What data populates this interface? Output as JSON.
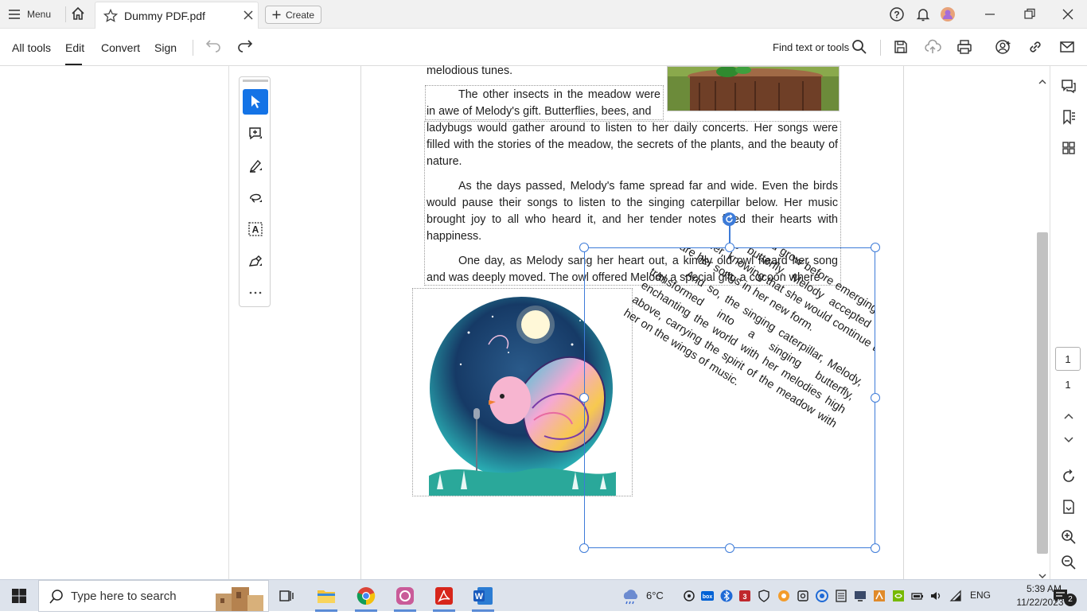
{
  "titlebar": {
    "menu_label": "Menu",
    "tab_title": "Dummy PDF.pdf",
    "create_label": "Create"
  },
  "toolbar": {
    "all_tools": "All tools",
    "edit": "Edit",
    "convert": "Convert",
    "sign": "Sign",
    "find_label": "Find text or tools"
  },
  "document": {
    "line0": "melodious tunes.",
    "para1_col": "The other insects in the meadow were in awe of Melody's gift. Butterflies, bees, and",
    "para1_rest": "ladybugs would gather around to listen to her daily concerts. Her songs were filled with the stories of the meadow, the secrets of the plants, and the beauty of nature.",
    "para2": "As the days passed, Melody's fame spread far and wide. Even the birds would pause their songs to listen to the singing caterpillar below. Her music brought joy to all who heard it, and her tender notes filled their hearts with happiness.",
    "para3": "One day, as Melody sang her heart out, a kindly old owl heard her song and was deeply moved. The owl offered Melody a special gift, a cocoon where",
    "rotated_para1": "she could rest and grow before emerging as a breathtaking butterfly. Melody accepted the owl's offer, knowing that she would continue to share her songs in her new form.",
    "rotated_para2": "And so, the singing caterpillar, Melody, transformed into a singing butterfly, enchanting the world with her melodies high above, carrying the spirit of the meadow with her on the wings of music."
  },
  "navigation": {
    "page_current": "1",
    "page_total": "1"
  },
  "taskbar": {
    "search_placeholder": "Type here to search",
    "temperature": "6°C",
    "language": "ENG",
    "time": "5:39 AM",
    "date": "11/22/2023",
    "notification_count": "2"
  },
  "colors": {
    "accent": "#1473e6",
    "selection": "#3d7bd8",
    "taskbar": "#dde3ec"
  }
}
